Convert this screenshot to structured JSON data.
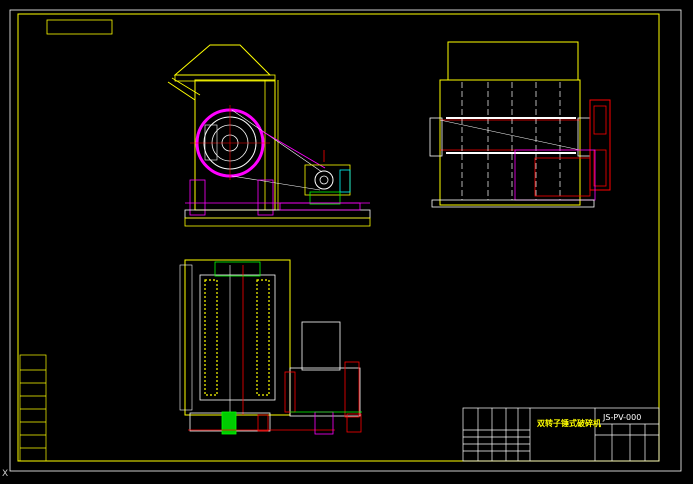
{
  "drawing": {
    "title": "双转子锤式破碎机",
    "code": "JS-PV-000",
    "axis_marker": "X"
  },
  "colors": {
    "border": "#ffff00",
    "frame": "#ffff00",
    "motor": "#ff00ff",
    "shaft": "#ff0000",
    "detail": "#00ff00",
    "text": "#ffffff",
    "cyan": "#00ffff"
  }
}
